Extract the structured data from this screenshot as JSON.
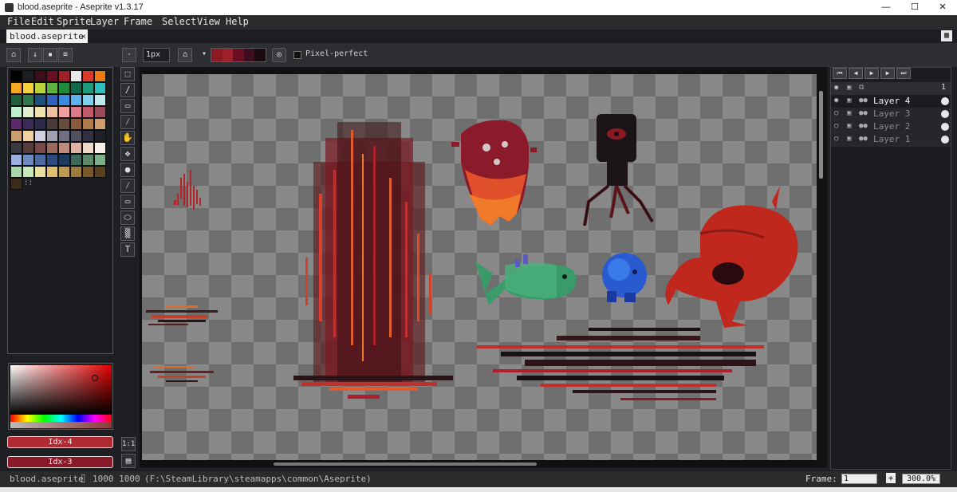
{
  "window": {
    "title": "blood.aseprite - Aseprite v1.3.17",
    "minimize_glyph": "—",
    "maximize_glyph": "☐",
    "close_glyph": "✕"
  },
  "menu": [
    "File",
    "Edit",
    "Sprite",
    "Layer",
    "Frame",
    "Select",
    "View",
    "Help"
  ],
  "tab": {
    "label": "blood.aseprite",
    "close": "×"
  },
  "toolbar": {
    "brush_size": "1px",
    "pixel_perfect_label": "Pixel-perfect",
    "swatches": [
      "#8b1a22",
      "#a0202a",
      "#6a0f22",
      "#3b0f1e",
      "#1a0a12"
    ]
  },
  "palette": {
    "colors": [
      "#000000",
      "#1d1d24",
      "#3c0f1a",
      "#6a0f22",
      "#a0202a",
      "#e8e8e8",
      "#d93a2a",
      "#f07a12",
      "#f5a623",
      "#f5d23a",
      "#b8d23a",
      "#5fb33a",
      "#1f8a3a",
      "#0f6a4a",
      "#1f9a7a",
      "#2fbfbf",
      "#1f5f3a",
      "#2f7a4a",
      "#1f4f7a",
      "#2f5fbf",
      "#3a8adf",
      "#5fb0ef",
      "#7fd0ef",
      "#bfe8ef",
      "#bfefd0",
      "#dfefd0",
      "#efe0b0",
      "#efc0a0",
      "#f0a0a0",
      "#e07a8a",
      "#c05a6a",
      "#9a4a5a",
      "#5a2a6a",
      "#3a2a5a",
      "#2a2a4a",
      "#4a3a3a",
      "#6a4a3a",
      "#8a5a3a",
      "#b07a4a",
      "#d09a6a",
      "#c8a070",
      "#f0d0a0",
      "#d0d0e0",
      "#a0a0b0",
      "#707080",
      "#505060",
      "#303040",
      "#202028",
      "#3a3a40",
      "#5a3a3a",
      "#7a4a4a",
      "#9a6a5a",
      "#c08a7a",
      "#e0b0a0",
      "#f0d8c8",
      "#f8f0e8",
      "#9ab0e0",
      "#6a8ac0",
      "#4a6aa0",
      "#2a4a80",
      "#1a3a60",
      "#3a6a5a",
      "#5a8a6a",
      "#7ab08a",
      "#a8d8a8",
      "#c8e8b8",
      "#e8e0a0",
      "#e0c070",
      "#c09a50",
      "#a07a3a",
      "#7a5a2a",
      "#5a4020",
      "#3a2a1a"
    ],
    "swatch_icon": "⁞⁞"
  },
  "color_picker": {
    "fg_label": "Idx-4",
    "bg_label": "Idx-3",
    "fg_color": "#b02a34",
    "bg_color": "#8a1a2a"
  },
  "tools": [
    "marquee",
    "lasso",
    "eraser",
    "eyedropper",
    "hand",
    "move",
    "paint-bucket",
    "line",
    "rectangle",
    "ellipse",
    "contour",
    "text"
  ],
  "tool_text_glyph": "T",
  "canvas_buttons": {
    "actual_size": "1:1",
    "preview_icon": "▤"
  },
  "timeline": {
    "frame_header": "1",
    "layers": [
      {
        "name": "Layer 4",
        "active": true
      },
      {
        "name": "Layer 3",
        "active": false
      },
      {
        "name": "Layer 2",
        "active": false
      },
      {
        "name": "Layer 1",
        "active": false
      }
    ]
  },
  "status": {
    "file": "blood.aseprite",
    "dimensions": "1000 1000",
    "path": "(F:\\SteamLibrary\\steamapps\\common\\Aseprite)",
    "frame_label": "Frame:",
    "frame_value": "1",
    "zoom": "300.0%",
    "plus": "+"
  }
}
